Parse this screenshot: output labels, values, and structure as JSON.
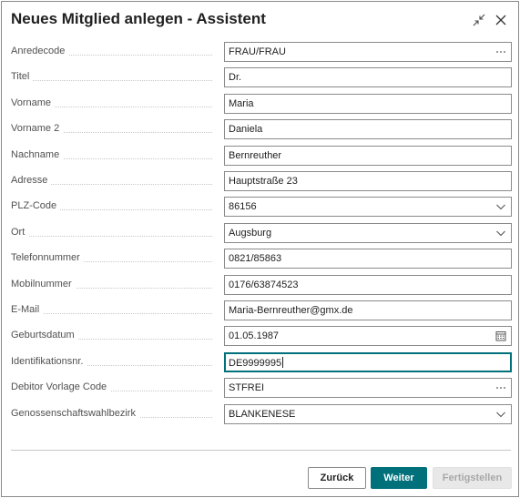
{
  "dialog": {
    "title": "Neues Mitglied anlegen - Assistent",
    "icons": {
      "collapse": "collapse-icon",
      "close": "close-icon"
    }
  },
  "fields": [
    {
      "key": "anredecode",
      "label": "Anredecode",
      "value": "FRAU/FRAU",
      "control": "lookup"
    },
    {
      "key": "titel",
      "label": "Titel",
      "value": "Dr.",
      "control": "text"
    },
    {
      "key": "vorname",
      "label": "Vorname",
      "value": "Maria",
      "control": "text"
    },
    {
      "key": "vorname2",
      "label": "Vorname 2",
      "value": "Daniela",
      "control": "text"
    },
    {
      "key": "nachname",
      "label": "Nachname",
      "value": "Bernreuther",
      "control": "text"
    },
    {
      "key": "adresse",
      "label": "Adresse",
      "value": "Hauptstraße 23",
      "control": "text"
    },
    {
      "key": "plz",
      "label": "PLZ-Code",
      "value": "86156",
      "control": "dropdown"
    },
    {
      "key": "ort",
      "label": "Ort",
      "value": "Augsburg",
      "control": "dropdown"
    },
    {
      "key": "telefon",
      "label": "Telefonnummer",
      "value": "0821/85863",
      "control": "text"
    },
    {
      "key": "mobil",
      "label": "Mobilnummer",
      "value": "0176/63874523",
      "control": "text"
    },
    {
      "key": "email",
      "label": "E-Mail",
      "value": "Maria-Bernreuther@gmx.de",
      "control": "text"
    },
    {
      "key": "geburtsdatum",
      "label": "Geburtsdatum",
      "value": "01.05.1987",
      "control": "date"
    },
    {
      "key": "identnr",
      "label": "Identifikationsnr.",
      "value": "DE9999995",
      "control": "text",
      "focused": true
    },
    {
      "key": "debitor",
      "label": "Debitor Vorlage Code",
      "value": "STFREI",
      "control": "lookup"
    },
    {
      "key": "bezirk",
      "label": "Genossenschaftswahlbezirk",
      "value": "BLANKENESE",
      "control": "dropdown"
    }
  ],
  "buttons": {
    "back": "Zurück",
    "next": "Weiter",
    "finish": "Fertigstellen"
  },
  "colors": {
    "accent": "#00707a",
    "disabled_bg": "#e8e8e8",
    "disabled_text": "#a8a8a8",
    "border": "#8a8a8a"
  }
}
